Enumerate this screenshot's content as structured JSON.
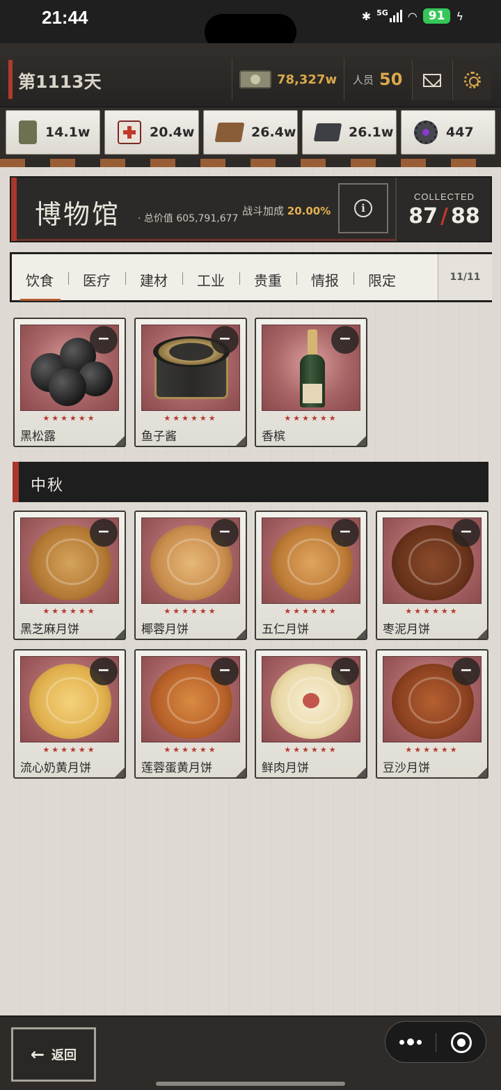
{
  "status_bar": {
    "time": "21:44",
    "network": "5G",
    "battery": "91",
    "icons": [
      "bluetooth-icon",
      "cellular-signal-icon",
      "wifi-icon",
      "battery-icon",
      "charging-bolt-icon"
    ]
  },
  "header": {
    "day_label": "第1113天",
    "money": "78,327w",
    "staff_label": "人员",
    "staff_count": "50",
    "mail_icon": "mail-icon",
    "settings_icon": "gear-icon"
  },
  "resources": [
    {
      "icon": "food-can-icon",
      "value": "14.1w"
    },
    {
      "icon": "medkit-icon",
      "value": "20.4w"
    },
    {
      "icon": "wood-icon",
      "value": "26.4w"
    },
    {
      "icon": "steel-icon",
      "value": "26.1w"
    },
    {
      "icon": "gear-part-icon",
      "value": "447"
    }
  ],
  "museum": {
    "title": "博物馆",
    "total_label": "· 总价值 605,791,677",
    "bonus_label": "战斗加成",
    "bonus_value": "20.00%",
    "collected_label": "COLLECTED",
    "collected": "87",
    "total": "88"
  },
  "tabs": {
    "items": [
      "饮食",
      "医疗",
      "建材",
      "工业",
      "贵重",
      "情报",
      "限定"
    ],
    "active": "饮食",
    "count": "11/11"
  },
  "items_top": [
    {
      "name": "黑松露",
      "stars": "★★★★★★"
    },
    {
      "name": "鱼子酱",
      "stars": "★★★★★★"
    },
    {
      "name": "香槟",
      "stars": "★★★★★★"
    }
  ],
  "section": {
    "title": "中秋"
  },
  "items_mid_autumn": [
    {
      "name": "黑芝麻月饼",
      "stars": "★★★★★★"
    },
    {
      "name": "椰蓉月饼",
      "stars": "★★★★★★"
    },
    {
      "name": "五仁月饼",
      "stars": "★★★★★★"
    },
    {
      "name": "枣泥月饼",
      "stars": "★★★★★★"
    },
    {
      "name": "流心奶黄月饼",
      "stars": "★★★★★★"
    },
    {
      "name": "莲蓉蛋黄月饼",
      "stars": "★★★★★★"
    },
    {
      "name": "鲜肉月饼",
      "stars": "★★★★★★"
    },
    {
      "name": "豆沙月饼",
      "stars": "★★★★★★"
    }
  ],
  "minus_symbol": "−",
  "bottom": {
    "back_label": "返回",
    "back_arrow": "←"
  },
  "colors": {
    "accent_red": "#a9372c",
    "gold": "#d9a94b",
    "star": "#b33a2f"
  }
}
